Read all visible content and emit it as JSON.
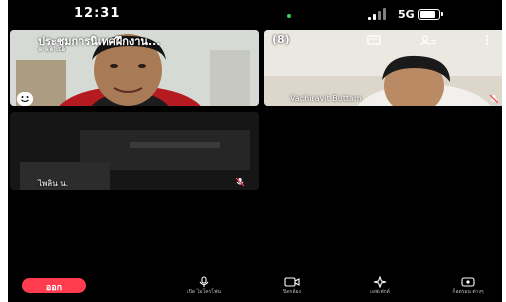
{
  "status_bar": {
    "time": "12:31",
    "network": "5G",
    "battery_level": 0.75
  },
  "tiles": {
    "main": {
      "meeting_title": "ประชุมการนิเทศฝึกงาน...",
      "meeting_time": "๑ ๑๑:๕๑"
    },
    "remote": {
      "participant_count": "(8)",
      "name": "Vachiravit Buttam"
    },
    "third": {
      "name": "ไพลิน น."
    }
  },
  "bottom_bar": {
    "leave_label": "ออก",
    "tools": [
      {
        "icon": "microphone-icon",
        "label": "เปิด ไมโครโฟน"
      },
      {
        "icon": "camera-icon",
        "label": "ปิดกล้อง"
      },
      {
        "icon": "effects-icon",
        "label": "เอฟเฟกต์"
      },
      {
        "icon": "more-icon",
        "label": "ก็อตรอน ต่างๆ"
      }
    ]
  },
  "colors": {
    "leave_button": "#ff3b4e",
    "background": "#000000"
  }
}
